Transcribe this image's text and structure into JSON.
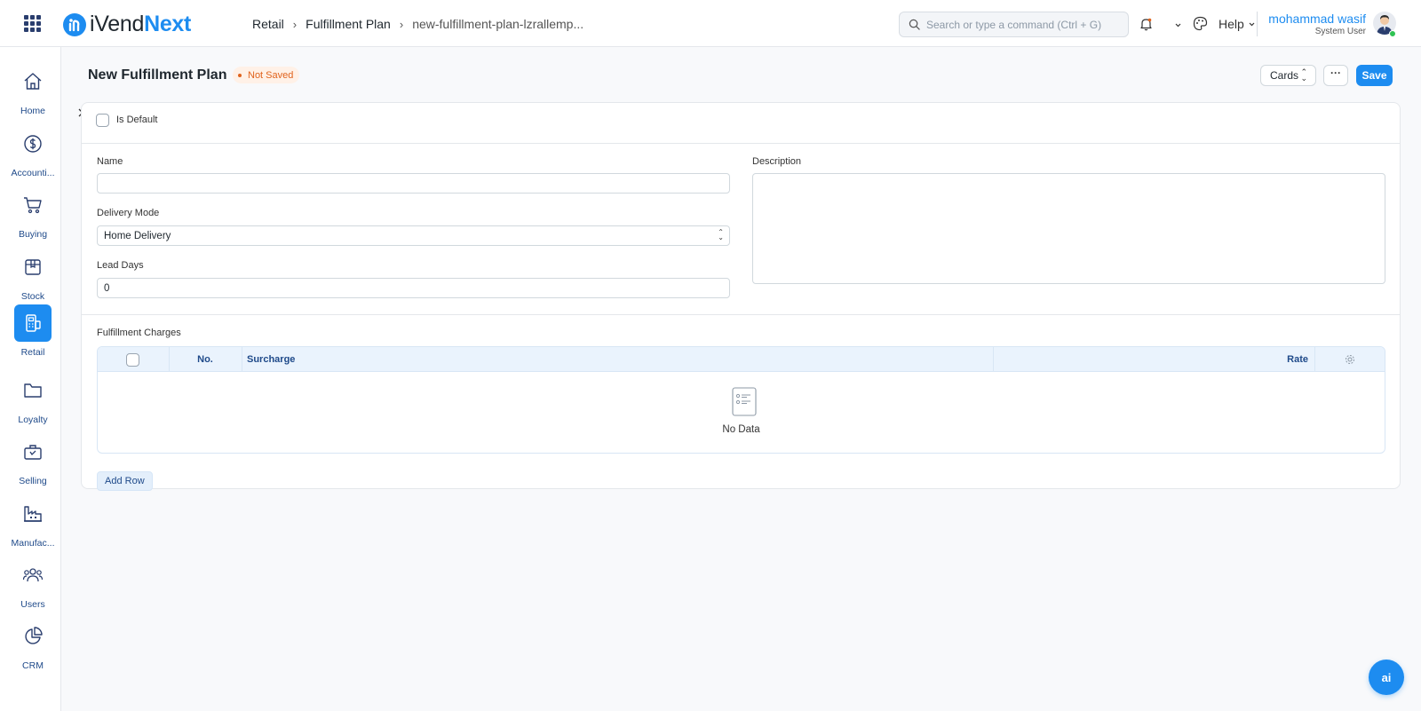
{
  "brand": {
    "name_prefix": "iVend",
    "name_suffix": "Next",
    "primary_color": "#1d8cf0"
  },
  "breadcrumb": {
    "items": [
      "Retail",
      "Fulfillment Plan",
      "new-fulfillment-plan-lzrallemp..."
    ]
  },
  "search": {
    "placeholder": "Search or type a command (Ctrl + G)"
  },
  "header": {
    "help_label": "Help",
    "user_name": "mohammad wasif",
    "user_role": "System User"
  },
  "sidebar": {
    "items": [
      {
        "label": "Home",
        "icon": "home-icon"
      },
      {
        "label": "Accounti...",
        "icon": "dollar-icon"
      },
      {
        "label": "Buying",
        "icon": "cart-icon"
      },
      {
        "label": "Stock",
        "icon": "box-icon"
      },
      {
        "label": "Retail",
        "icon": "pos-icon",
        "active": true
      },
      {
        "label": "Loyalty",
        "icon": "folder-icon"
      },
      {
        "label": "Selling",
        "icon": "bag-icon"
      },
      {
        "label": "Manufac...",
        "icon": "factory-icon"
      },
      {
        "label": "Users",
        "icon": "users-icon"
      },
      {
        "label": "CRM",
        "icon": "pie-chart-icon"
      }
    ]
  },
  "page": {
    "title": "New Fulfillment Plan",
    "status": "Not Saved",
    "view_select": "Cards",
    "more_label": "···",
    "save_label": "Save"
  },
  "form": {
    "is_default_label": "Is Default",
    "is_default_checked": false,
    "name": {
      "label": "Name",
      "value": ""
    },
    "delivery_mode": {
      "label": "Delivery Mode",
      "value": "Home Delivery"
    },
    "lead_days": {
      "label": "Lead Days",
      "value": "0"
    },
    "description": {
      "label": "Description",
      "value": ""
    }
  },
  "charges": {
    "section_label": "Fulfillment Charges",
    "columns": {
      "no": "No.",
      "surcharge": "Surcharge",
      "rate": "Rate"
    },
    "empty_text": "No Data",
    "add_row_label": "Add Row"
  },
  "ai_button_label": "ai"
}
